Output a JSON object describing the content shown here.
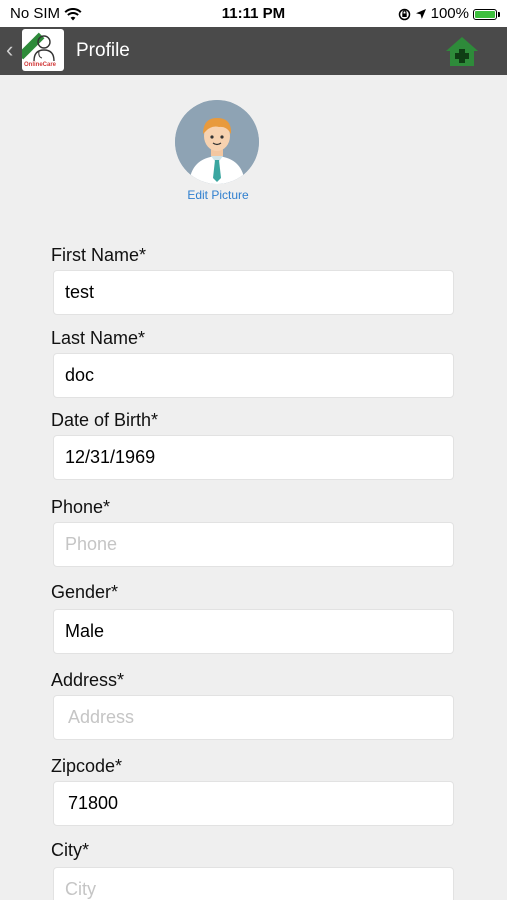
{
  "status_bar": {
    "carrier": "No SIM",
    "time": "11:11 PM",
    "battery": "100%"
  },
  "nav": {
    "title": "Profile",
    "logo_text": "OnlineCare",
    "home_icon": "home-plus-icon",
    "accent": "#2e8b3a"
  },
  "profile": {
    "edit_picture": "Edit Picture"
  },
  "fields": [
    {
      "label": "First Name*",
      "value": "test",
      "placeholder": ""
    },
    {
      "label": "Last Name*",
      "value": "doc",
      "placeholder": ""
    },
    {
      "label": "Date of Birth*",
      "value": "12/31/1969",
      "placeholder": ""
    },
    {
      "label": "Phone*",
      "value": "",
      "placeholder": "Phone"
    },
    {
      "label": "Gender*",
      "value": "Male",
      "placeholder": ""
    },
    {
      "label": "Address*",
      "value": "",
      "placeholder": "Address"
    },
    {
      "label": "Zipcode*",
      "value": "71800",
      "placeholder": ""
    },
    {
      "label": "City*",
      "value": "",
      "placeholder": "City"
    }
  ]
}
